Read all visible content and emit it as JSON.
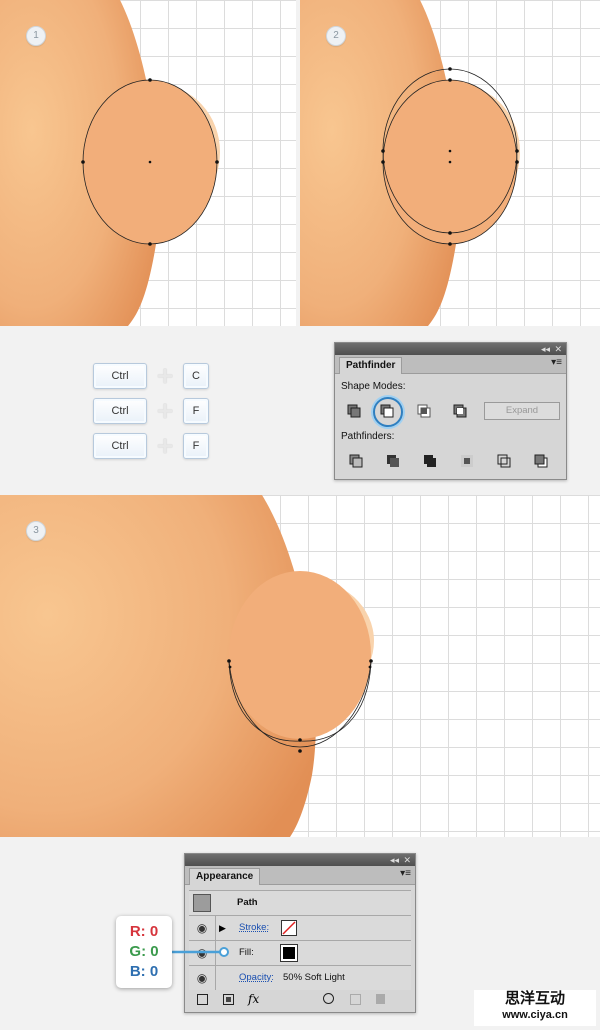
{
  "steps": {
    "one": "1",
    "two": "2",
    "three": "3"
  },
  "shortcuts": [
    {
      "mod": "Ctrl",
      "key": "C"
    },
    {
      "mod": "Ctrl",
      "key": "F"
    },
    {
      "mod": "Ctrl",
      "key": "F"
    }
  ],
  "pathfinder": {
    "title": "Pathfinder",
    "shape_modes_label": "Shape Modes:",
    "expand_label": "Expand",
    "pathfinders_label": "Pathfinders:",
    "collapse_glyph": "◂◂",
    "close_glyph": "✕",
    "menu_glyph": "▾≡"
  },
  "appearance": {
    "title": "Appearance",
    "object_label": "Path",
    "stroke_label": "Stroke:",
    "fill_label": "Fill:",
    "opacity_label": "Opacity:",
    "opacity_value": "50% Soft Light",
    "fx_label": "fx",
    "collapse_glyph": "◂◂",
    "close_glyph": "✕",
    "menu_glyph": "▾≡"
  },
  "color_callout": {
    "r": "R: 0",
    "g": "G: 0",
    "b": "B: 0",
    "r_color": "#d6343c",
    "g_color": "#3a9a4c",
    "b_color": "#2e6fb0"
  },
  "watermark": {
    "line1": "思洋互动",
    "line2": "www.ciya.cn"
  },
  "colors": {
    "skin_light": "#f8c690",
    "skin_dark": "#e49a5e",
    "ear": "#f2ae7a",
    "highlight": "#f9d3ac",
    "selection": "#4aa0d8"
  }
}
